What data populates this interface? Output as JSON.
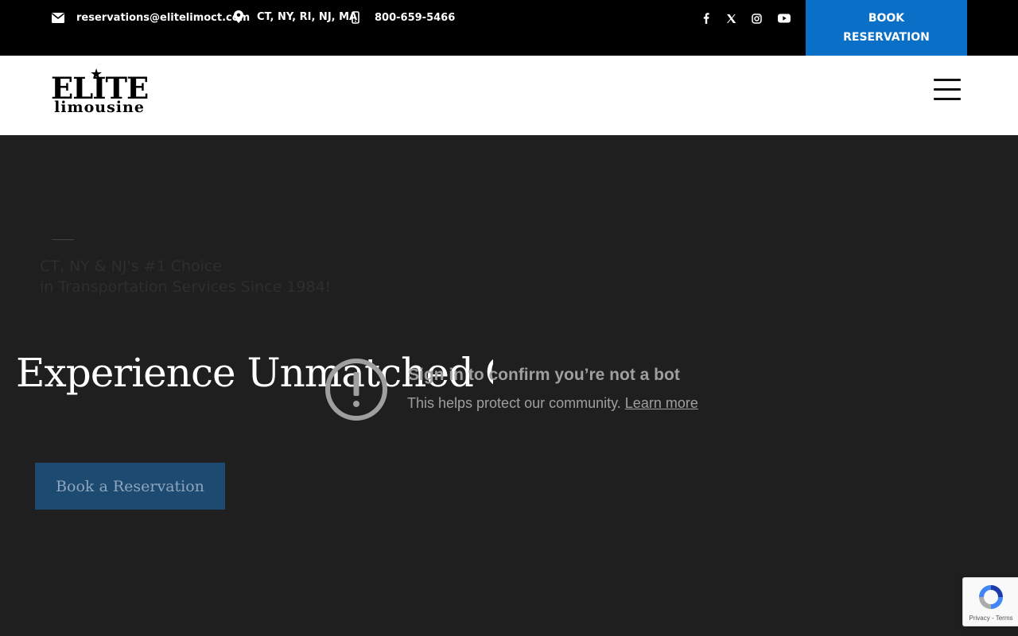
{
  "topbar": {
    "email": "reservations@elitelimoct.com",
    "location": "CT, NY, RI, NJ, MA",
    "phone": "800-659-5466",
    "social_icons": [
      "facebook-icon",
      "x-twitter-icon",
      "instagram-icon",
      "youtube-icon"
    ],
    "book_button": {
      "line1": "BOOK",
      "line2": "RESERVATION"
    }
  },
  "header": {
    "logo": {
      "line1": "ELITE",
      "line2": "limousine"
    }
  },
  "hero": {
    "subtitle_line1": "CT, NY & NJ's #1 Choice",
    "subtitle_line2": "in Transportation Services Since 1984!",
    "title": "Experience Unmatched Comfort & Class",
    "button_label": "Book a Reservation"
  },
  "bot_overlay": {
    "title": "Sign in to confirm you’re not a bot",
    "text": "This helps protect our community.",
    "link": "Learn more"
  },
  "recaptcha": {
    "privacy": "Privacy",
    "separator": " - ",
    "terms": "Terms"
  },
  "colors": {
    "topbar_bg": "#000000",
    "accent": "#0a6fc7",
    "hero_bg": "#1f1f20",
    "hero_button": "#1c4a71"
  }
}
